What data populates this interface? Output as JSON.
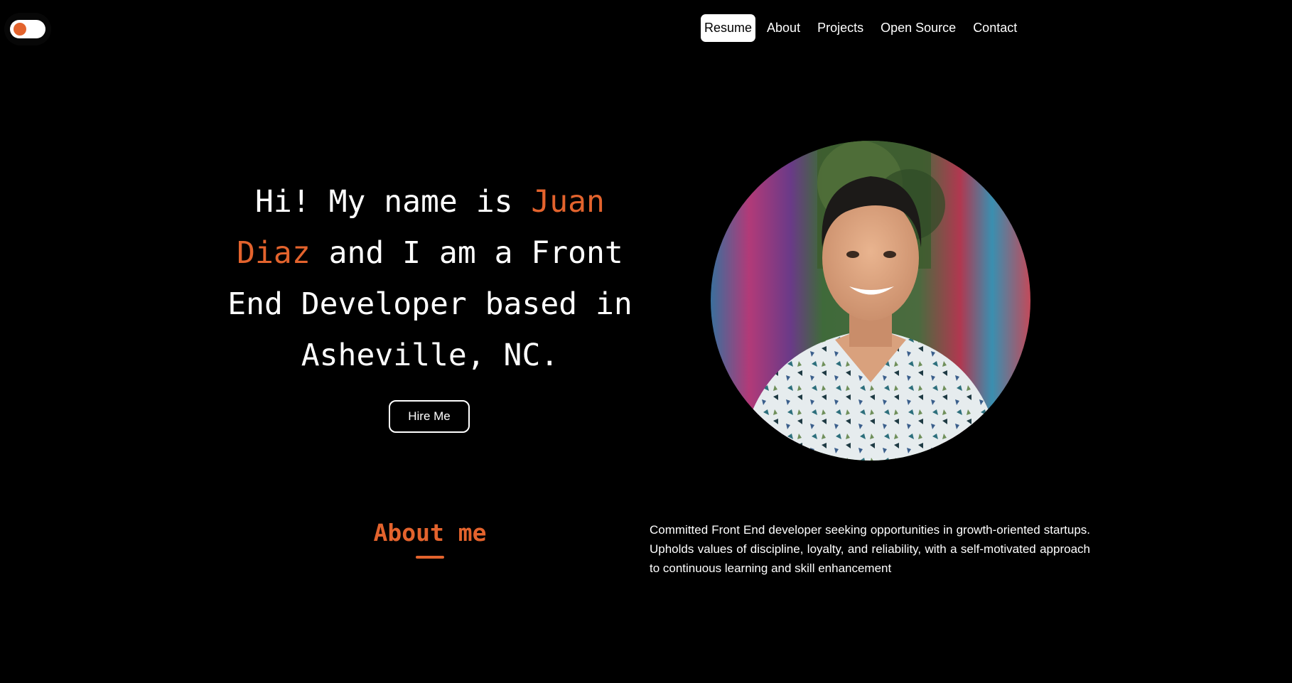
{
  "theme_toggle": {
    "state": "dark",
    "accent_color": "#e3632d"
  },
  "nav": {
    "items": [
      {
        "label": "Resume",
        "active": true
      },
      {
        "label": "About",
        "active": false
      },
      {
        "label": "Projects",
        "active": false
      },
      {
        "label": "Open Source",
        "active": false
      },
      {
        "label": "Contact",
        "active": false
      }
    ]
  },
  "hero": {
    "intro": "Hi! My name is ",
    "name": "Juan Diaz",
    "rest": " and I am a Front End Developer based in Asheville, NC.",
    "cta_label": "Hire Me"
  },
  "portrait": {
    "icon": "profile-photo"
  },
  "about": {
    "heading": "About me",
    "text": "Committed Front End developer seeking opportunities in growth-oriented startups. Upholds values of discipline, loyalty, and reliability, with a self-motivated approach to continuous learning and skill enhancement"
  },
  "colors": {
    "background": "#000000",
    "accent": "#e3632d",
    "text": "#ffffff"
  }
}
